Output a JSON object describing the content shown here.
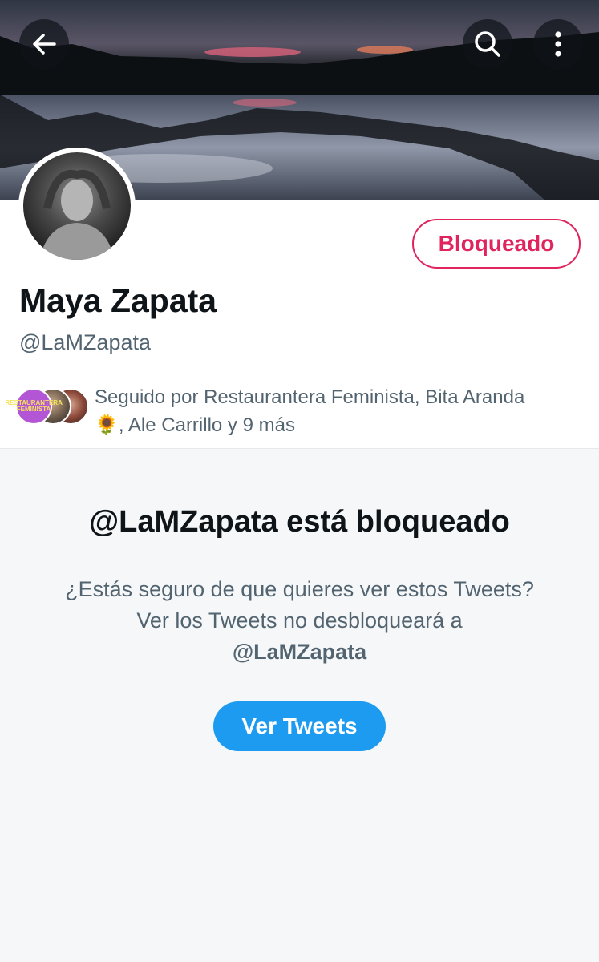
{
  "header": {
    "back_icon": "arrow-left-icon",
    "search_icon": "search-icon",
    "more_icon": "more-vertical-icon"
  },
  "profile": {
    "display_name": "Maya Zapata",
    "handle": "@LaMZapata",
    "blocked_label": "Bloqueado",
    "followed_by_prefix": "Seguido por Restaurantera Feminista, Bita Aranda",
    "followed_by_emoji": "🌻",
    "followed_by_suffix": ", Ale Carrillo y 9 más",
    "follower_avatar_text": "RESTAURANTERA FEMINISTA"
  },
  "blocked_notice": {
    "title": "@LaMZapata está bloqueado",
    "description": "¿Estás seguro de que quieres ver estos Tweets? Ver los Tweets no desbloqueará a",
    "handle": "@LaMZapata",
    "button_label": "Ver Tweets"
  },
  "colors": {
    "accent": "#1d9bf0",
    "blocked": "#e0245e",
    "secondary_text": "#536471"
  }
}
